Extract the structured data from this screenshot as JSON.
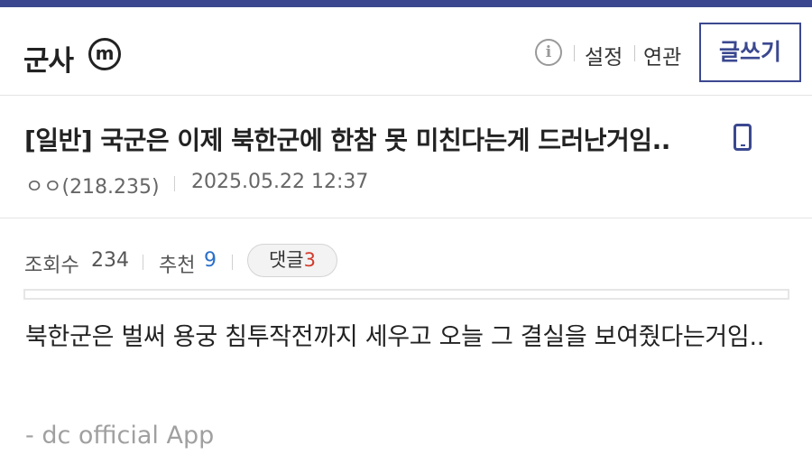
{
  "header": {
    "gallery_name": "군사",
    "badge_letter": "m",
    "info_glyph": "i",
    "settings_label": "설정",
    "related_label": "연관",
    "write_label": "글쓰기",
    "icons": [
      "m-badge-icon",
      "info-icon"
    ]
  },
  "post": {
    "title": "[일반] 국군은 이제 북한군에 한참 못 미친다는게 드러난거임..",
    "title_icon": "mobile-icon",
    "author": "ㅇㅇ(218.235)",
    "date": "2025.05.22 12:37"
  },
  "stats": {
    "views_label": "조회수",
    "views_value": "234",
    "recommend_label": "추천",
    "recommend_value": "9",
    "comment_label": "댓글",
    "comment_value": "3"
  },
  "content": {
    "body": "북한군은 벌써 용궁 침투작전까지 세우고 오늘 그 결실을 보여줬다는거임..",
    "signature": "- dc official App"
  },
  "colors": {
    "brand": "#3b4890",
    "recommend": "#2a6fc9",
    "comment_count": "#d23b2d"
  }
}
